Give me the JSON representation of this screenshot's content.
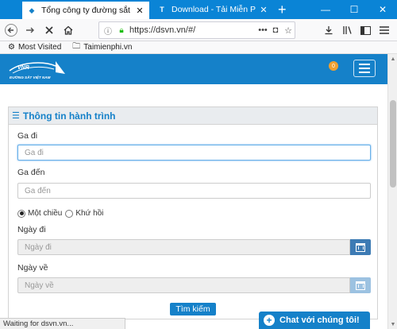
{
  "browser": {
    "tabs": [
      {
        "title": "Tổng công ty đường sắt Việt N",
        "active": true
      },
      {
        "title": "Download - Tải Miễn Phí VN - P",
        "active": false
      }
    ],
    "new_tab": "+",
    "url": "https://dsvn.vn/#/",
    "bookmarks": [
      "Most Visited",
      "Taimienphi.vn"
    ],
    "status": "Waiting for dsvn.vn..."
  },
  "site": {
    "logo_text": "VNR",
    "logo_subtext": "ĐƯỜNG SẮT VIỆT NAM",
    "notification_count": "0"
  },
  "form": {
    "panel_title": "Thông tin hành trình",
    "from_label": "Ga đi",
    "from_placeholder": "Ga đi",
    "to_label": "Ga đến",
    "to_placeholder": "Ga đến",
    "trip_types": [
      {
        "label": "Một chiều",
        "checked": true
      },
      {
        "label": "Khứ hồi",
        "checked": false
      }
    ],
    "depart_label": "Ngày đi",
    "depart_placeholder": "Ngày đi",
    "return_label": "Ngày về",
    "return_placeholder": "Ngày về",
    "search_label": "Tìm kiếm"
  },
  "chat": {
    "label": "Chat với chúng tôi!"
  },
  "colors": {
    "brand": "#1581c9",
    "tabstrip": "#0a84d6"
  }
}
